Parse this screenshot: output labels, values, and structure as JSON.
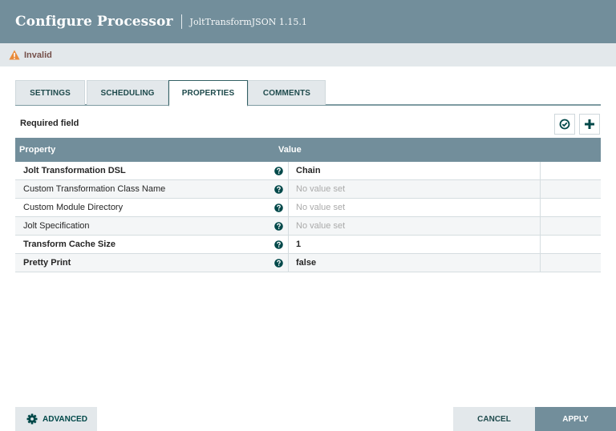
{
  "header": {
    "title": "Configure Processor",
    "subtitle": "JoltTransformJSON 1.15.1"
  },
  "status": {
    "icon": "warning-icon",
    "text": "Invalid",
    "color": "#e98a39"
  },
  "tabs": [
    {
      "label": "SETTINGS",
      "active": false
    },
    {
      "label": "SCHEDULING",
      "active": false
    },
    {
      "label": "PROPERTIES",
      "active": true
    },
    {
      "label": "COMMENTS",
      "active": false
    }
  ],
  "properties": {
    "required_label": "Required field",
    "toolbar": {
      "verify_icon": "check-circle-icon",
      "add_icon": "plus-icon"
    },
    "columns": {
      "property": "Property",
      "value": "Value"
    },
    "rows": [
      {
        "name": "Jolt Transformation DSL",
        "required": true,
        "value": "Chain",
        "is_set": true
      },
      {
        "name": "Custom Transformation Class Name",
        "required": false,
        "value": "No value set",
        "is_set": false
      },
      {
        "name": "Custom Module Directory",
        "required": false,
        "value": "No value set",
        "is_set": false
      },
      {
        "name": "Jolt Specification",
        "required": false,
        "value": "No value set",
        "is_set": false
      },
      {
        "name": "Transform Cache Size",
        "required": true,
        "value": "1",
        "is_set": true
      },
      {
        "name": "Pretty Print",
        "required": true,
        "value": "false",
        "is_set": true
      }
    ]
  },
  "footer": {
    "advanced_label": "ADVANCED",
    "cancel_label": "CANCEL",
    "apply_label": "APPLY"
  },
  "colors": {
    "header_bg": "#728e9b",
    "accent": "#004849",
    "light_bg": "#e3e8eb"
  }
}
